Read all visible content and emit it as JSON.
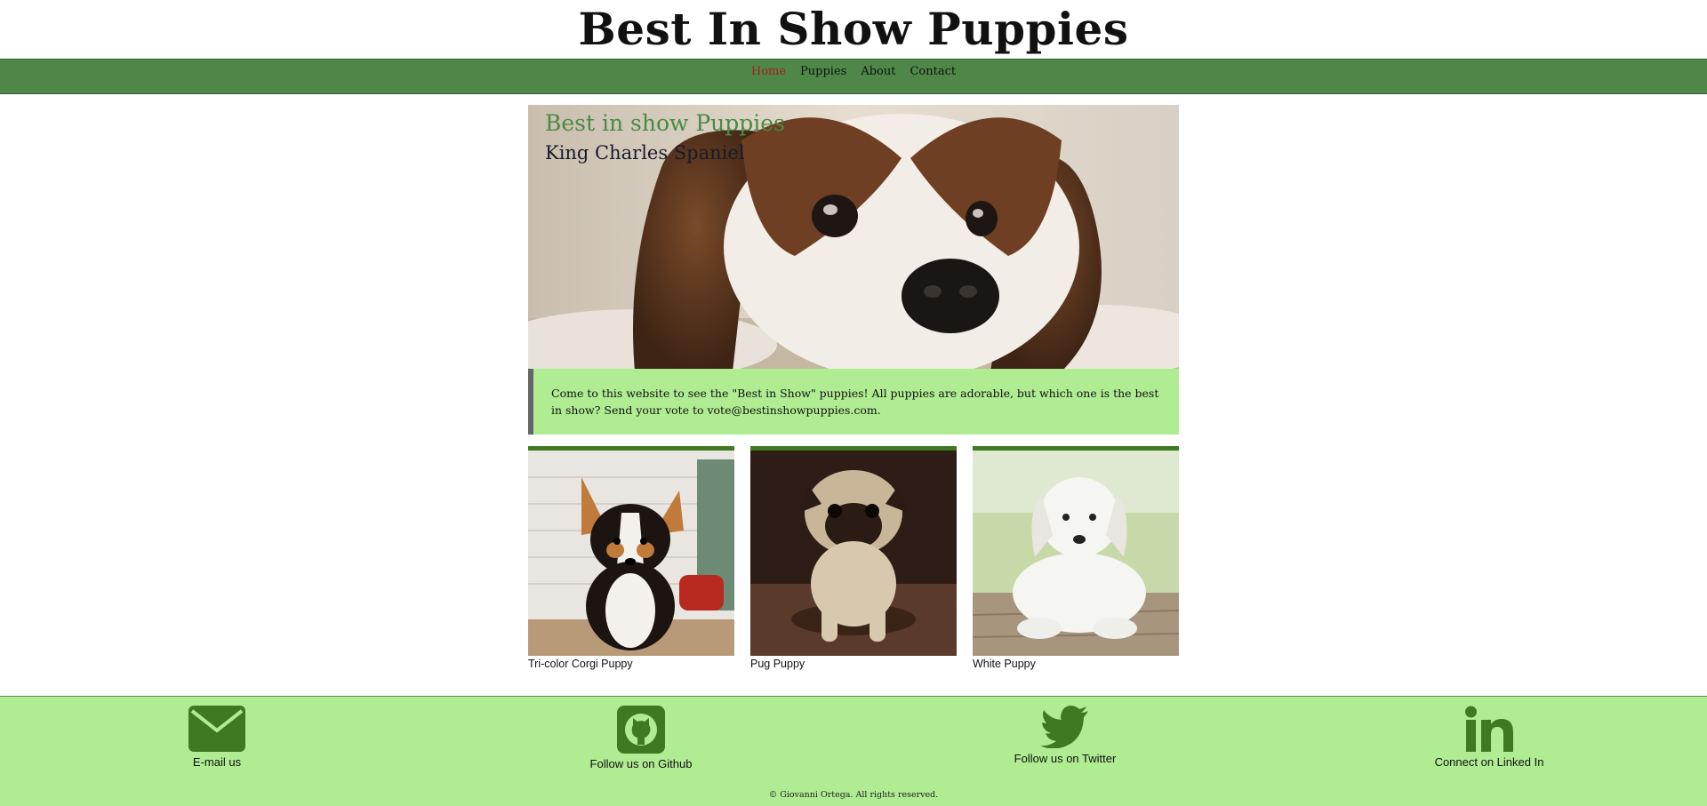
{
  "site": {
    "title": "Best In Show Puppies"
  },
  "nav": {
    "items": [
      {
        "label": "Home",
        "active": true
      },
      {
        "label": "Puppies",
        "active": false
      },
      {
        "label": "About",
        "active": false
      },
      {
        "label": "Contact",
        "active": false
      }
    ]
  },
  "hero": {
    "title": "Best in show Puppies",
    "subtitle": "King Charles Spaniel"
  },
  "intro": {
    "text": "Come to this website to see the \"Best in Show\" puppies! All puppies are adorable, but which one is the best in show? Send your vote to vote@bestinshowpuppies.com."
  },
  "gallery": {
    "cards": [
      {
        "caption": "Tri-color Corgi Puppy"
      },
      {
        "caption": "Pug Puppy"
      },
      {
        "caption": "White Puppy"
      }
    ]
  },
  "footer": {
    "links": [
      {
        "label": "E-mail us",
        "icon": "envelope-icon"
      },
      {
        "label": "Follow us on Github",
        "icon": "github-icon"
      },
      {
        "label": "Follow us on Twitter",
        "icon": "twitter-icon"
      },
      {
        "label": "Connect on Linked In",
        "icon": "linkedin-icon"
      }
    ],
    "copyright": "© Giovanni Ortega. All rights reserved."
  },
  "colors": {
    "nav_bg": "#4f8748",
    "accent_green": "#3f7a22",
    "light_green": "#b0ec92",
    "active_link": "#a81e1e"
  }
}
